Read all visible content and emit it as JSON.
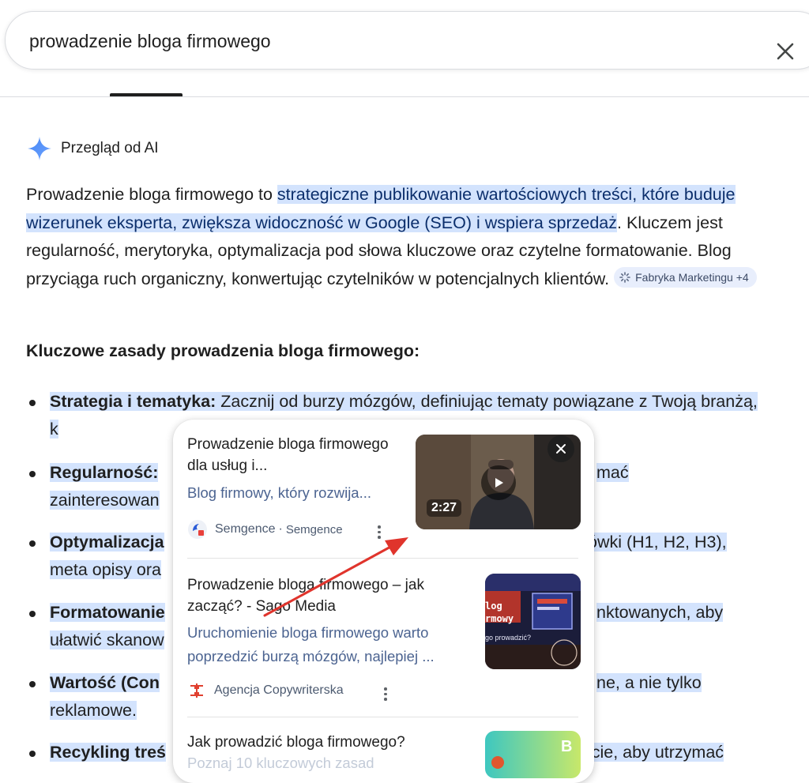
{
  "search": {
    "query": "prowadzenie bloga firmowego"
  },
  "ai_overview": {
    "title": "Przegląd od AI",
    "summary": {
      "intro": "Prowadzenie bloga firmowego to ",
      "highlight": "strategiczne publikowanie wartościowych treści, które buduje wizerunek eksperta, zwiększa widoczność w Google (SEO) i wspiera sprzedaż",
      "rest": ". Kluczem jest regularność, merytoryka, optymalizacja pod słowa kluczowe oraz czytelne formatowanie. Blog przyciąga ruch organiczny, konwertując czytelników w potencjalnych klientów.",
      "source_chip": "Fabryka Marketingu +4"
    },
    "heading": "Kluczowe zasady prowadzenia bloga firmowego:",
    "bullets": [
      {
        "bold": "Strategia i tematyka:",
        "text": " Zacznij od burzy mózgów, definiując tematy powiązane z Twoją branżą, k",
        "hidden": ""
      },
      {
        "bold": "Regularność:",
        "text": "",
        "tail": "mać",
        "line2": "zainteresowan"
      },
      {
        "bold": "Optymalizacja",
        "text": "",
        "tail": "ówki (H1, H2, H3),",
        "line2": "meta opisy ora"
      },
      {
        "bold": "Formatowanie",
        "text": "",
        "tail": "nktowanych, aby",
        "line2": "ułatwić skanow"
      },
      {
        "bold": "Wartość (Con",
        "text": "",
        "tail": "ne, a nie tylko",
        "line2": "reklamowe."
      },
      {
        "bold": "Recykling treś",
        "text": "",
        "tail": "ycie, aby utrzymać",
        "line2": ""
      }
    ]
  },
  "popover": {
    "cards": [
      {
        "title": "Prowadzenie bloga firmowego dla usług i...",
        "snippet": "Blog firmowy, który rozwija...",
        "source_name": "Semgence",
        "source_sep": "·",
        "source_publisher": "Semgence",
        "video_duration": "2:27"
      },
      {
        "title": "Prowadzenie bloga firmowego – jak zacząć? - Sago Media",
        "snippet": "Uruchomienie bloga firmowego warto poprzedzić burzą mózgów, najlepiej ...",
        "source_name": "Agencja Copywriterska",
        "thumb_text_1": "log",
        "thumb_text_2": "rmowy",
        "thumb_text_3": "go prowadzić?"
      },
      {
        "title": "Jak prowadzić bloga firmowego?",
        "snippet": "Poznaj 10 kluczowych zasad"
      }
    ]
  },
  "colors": {
    "highlight_bg": "#d3e3fd",
    "link_snippet": "#4c6491",
    "annotation_arrow": "#e0342c",
    "ai_sparkle": "#4285f4"
  }
}
